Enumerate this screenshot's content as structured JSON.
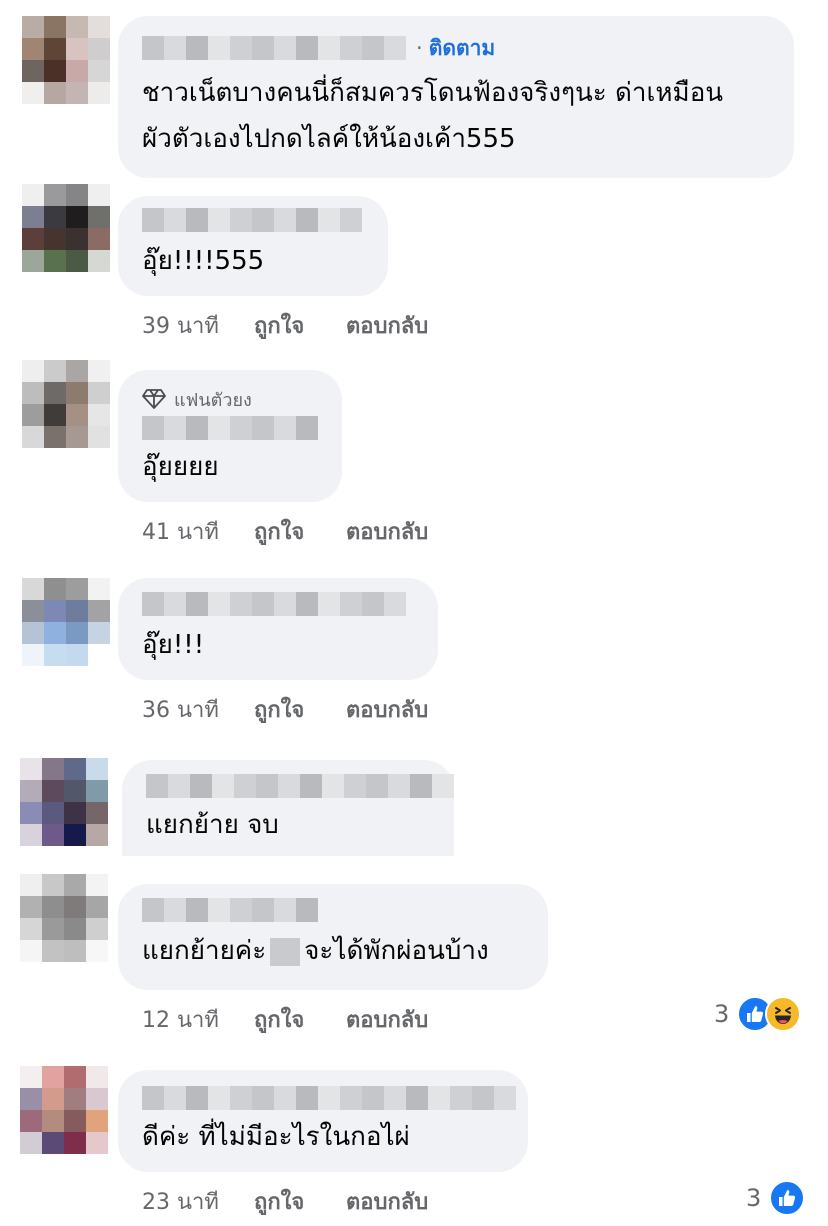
{
  "comments": [
    {
      "follow_label": "ติดตาม",
      "follow_separator": "·",
      "text_line1": "ชาวเน็ตบางคนนี่ก็สมควรโดนฟ้องจริงๆนะ ด่าเหมือน",
      "text_line2": "ผัวตัวเองไปกดไลค์ให้น้องเค้า555"
    },
    {
      "text": "อุ๊ย!!!!555",
      "time": "39 นาที",
      "like_label": "ถูกใจ",
      "reply_label": "ตอบกลับ"
    },
    {
      "badge": "แฟนตัวยง",
      "text": "อุ๊ยยยย",
      "time": "41 นาที",
      "like_label": "ถูกใจ",
      "reply_label": "ตอบกลับ"
    },
    {
      "text": "อุ๊ย!!!",
      "time": "36 นาที",
      "like_label": "ถูกใจ",
      "reply_label": "ตอบกลับ"
    },
    {
      "text": "แยกย้าย จบ"
    },
    {
      "text_before": "แยกย้ายค่ะ",
      "text_after": "จะได้พักผ่อนบ้าง",
      "time": "12 นาที",
      "like_label": "ถูกใจ",
      "reply_label": "ตอบกลับ",
      "reaction_count": "3",
      "reactions": [
        "like-icon",
        "haha-icon"
      ]
    },
    {
      "text": "ดีค่ะ ที่ไม่มีอะไรในกอไผ่",
      "time": "23 นาที",
      "like_label": "ถูกใจ",
      "reply_label": "ตอบกลับ",
      "reaction_count": "3",
      "reactions": [
        "like-icon"
      ]
    }
  ],
  "colors": {
    "bubble": "#f0f2f5",
    "link": "#216fdb",
    "meta": "#65676b",
    "like_blue": "#1877f2",
    "haha_yellow": "#f7b928"
  }
}
